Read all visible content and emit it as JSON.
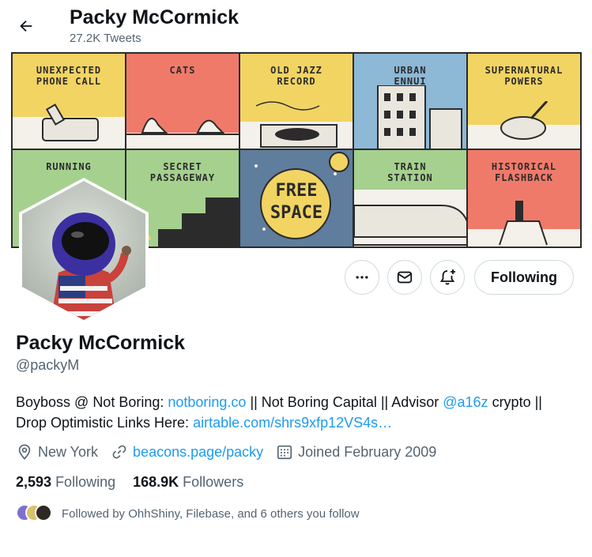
{
  "header": {
    "title": "Packy McCormick",
    "tweet_count": "27.2K Tweets"
  },
  "banner": {
    "tiles": [
      {
        "line1": "UNEXPECTED",
        "line2": "PHONE CALL",
        "color": "#f2d463"
      },
      {
        "line1": "CATS",
        "line2": "",
        "color": "#f07a6a"
      },
      {
        "line1": "OLD JAZZ",
        "line2": "RECORD",
        "color": "#f2d463"
      },
      {
        "line1": "URBAN",
        "line2": "ENNUI",
        "color": "#8db8d6"
      },
      {
        "line1": "SUPERNATURAL",
        "line2": "POWERS",
        "color": "#f2d463"
      },
      {
        "line1": "RUNNING",
        "line2": "",
        "color": "#a5d08e"
      },
      {
        "line1": "SECRET",
        "line2": "PASSAGEWAY",
        "color": "#a5d08e"
      },
      {
        "line1": "FREE",
        "line2": "SPACE",
        "color": "#5f7d9c"
      },
      {
        "line1": "TRAIN",
        "line2": "STATION",
        "color": "#a5d08e"
      },
      {
        "line1": "HISTORICAL",
        "line2": "FLASHBACK",
        "color": "#f07a6a"
      }
    ]
  },
  "actions": {
    "following_label": "Following"
  },
  "profile": {
    "name": "Packy McCormick",
    "handle": "@packyM",
    "bio_part1": "Boyboss @ Not Boring: ",
    "bio_link1": "notboring.co",
    "bio_part2": " || Not Boring Capital || Advisor ",
    "bio_link2": "@a16z",
    "bio_part3": " crypto || Drop Optimistic Links Here: ",
    "bio_link3": "airtable.com/shrs9xfp12VS4s…",
    "location": "New York",
    "website": "beacons.page/packy",
    "joined": "Joined February 2009"
  },
  "stats": {
    "following_count": "2,593",
    "following_label": "Following",
    "followers_count": "168.9K",
    "followers_label": "Followers"
  },
  "followed_by": "Followed by OhhShiny, Filebase, and 6 others you follow",
  "colors": {
    "accent": "#1d9bf0",
    "secondary_text": "#536471",
    "border": "#cfd9de"
  }
}
